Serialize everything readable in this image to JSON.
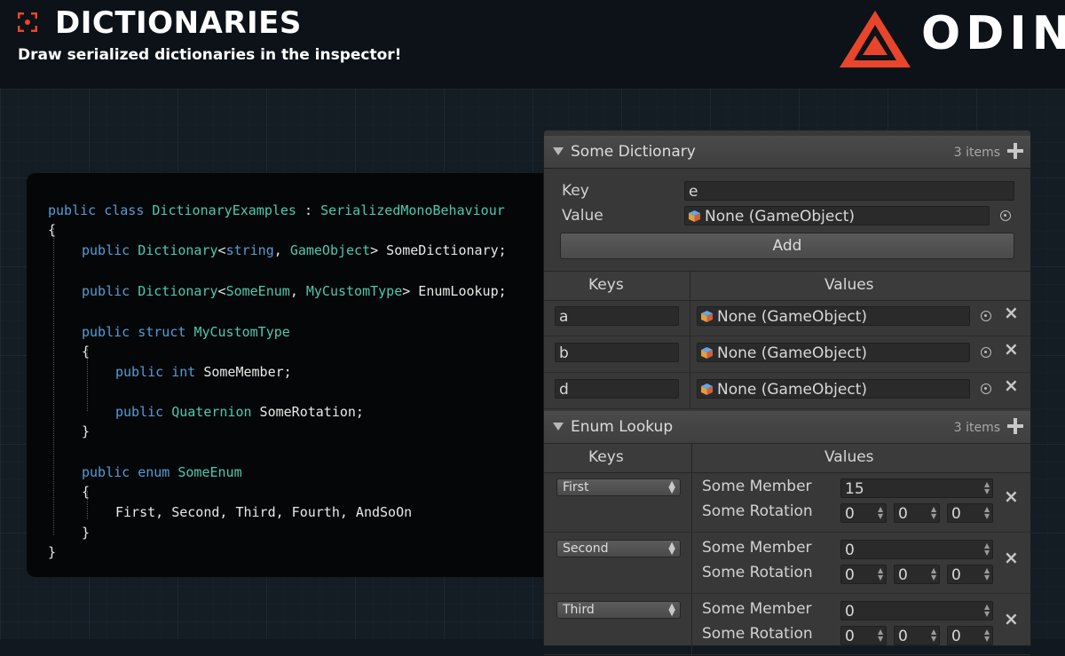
{
  "header": {
    "title": "DICTIONARIES",
    "subtitle": "Draw serialized dictionaries in the inspector!",
    "logo_text": "ODIN",
    "logo_color": "#e8452c"
  },
  "code": {
    "lines": [
      {
        "indent": 0,
        "parts": [
          [
            "kw",
            "public class "
          ],
          [
            "ty",
            "DictionaryExamples"
          ],
          [
            "pl",
            " : "
          ],
          [
            "ty",
            "SerializedMonoBehaviour"
          ]
        ]
      },
      {
        "indent": 0,
        "parts": [
          [
            "pl",
            "{"
          ]
        ]
      },
      {
        "indent": 1,
        "parts": [
          [
            "kw",
            "public "
          ],
          [
            "ty",
            "Dictionary"
          ],
          [
            "pl",
            "<"
          ],
          [
            "kw",
            "string"
          ],
          [
            "pl",
            ", "
          ],
          [
            "ty",
            "GameObject"
          ],
          [
            "pl",
            "> SomeDictionary;"
          ]
        ]
      },
      {
        "indent": 1,
        "parts": [
          [
            "kw",
            "public "
          ],
          [
            "ty",
            "Dictionary"
          ],
          [
            "pl",
            "<"
          ],
          [
            "ty",
            "SomeEnum"
          ],
          [
            "pl",
            ", "
          ],
          [
            "ty",
            "MyCustomType"
          ],
          [
            "pl",
            "> EnumLookup;"
          ]
        ]
      },
      {
        "indent": 1,
        "parts": [
          [
            "kw",
            "public struct "
          ],
          [
            "ty",
            "MyCustomType"
          ]
        ]
      },
      {
        "indent": 1,
        "parts": [
          [
            "pl",
            "{"
          ]
        ]
      },
      {
        "indent": 2,
        "parts": [
          [
            "kw",
            "public int "
          ],
          [
            "pl",
            "SomeMember;"
          ]
        ]
      },
      {
        "indent": 2,
        "parts": [
          [
            "kw",
            "public "
          ],
          [
            "ty",
            "Quaternion"
          ],
          [
            "pl",
            " SomeRotation;"
          ]
        ]
      },
      {
        "indent": 1,
        "parts": [
          [
            "pl",
            "}"
          ]
        ]
      },
      {
        "indent": 1,
        "parts": [
          [
            "kw",
            "public enum "
          ],
          [
            "ty",
            "SomeEnum"
          ]
        ]
      },
      {
        "indent": 1,
        "parts": [
          [
            "pl",
            "{"
          ]
        ]
      },
      {
        "indent": 2,
        "parts": [
          [
            "pl",
            "First, Second, Third, Fourth, AndSoOn"
          ]
        ]
      },
      {
        "indent": 1,
        "parts": [
          [
            "pl",
            "}"
          ]
        ]
      },
      {
        "indent": 0,
        "parts": [
          [
            "pl",
            "}"
          ]
        ]
      }
    ]
  },
  "some_dictionary": {
    "title": "Some Dictionary",
    "count": "3 items",
    "key_label": "Key",
    "key_value": "e",
    "value_label": "Value",
    "value_value": "None (GameObject)",
    "add_label": "Add",
    "col_keys": "Keys",
    "col_values": "Values",
    "rows": [
      {
        "key": "a",
        "value": "None (GameObject)"
      },
      {
        "key": "b",
        "value": "None (GameObject)"
      },
      {
        "key": "d",
        "value": "None (GameObject)"
      }
    ]
  },
  "enum_lookup": {
    "title": "Enum Lookup",
    "count": "3 items",
    "col_keys": "Keys",
    "col_values": "Values",
    "member_label": "Some Member",
    "rotation_label": "Some Rotation",
    "rows": [
      {
        "key": "First",
        "member": "15",
        "rot": [
          "0",
          "0",
          "0"
        ]
      },
      {
        "key": "Second",
        "member": "0",
        "rot": [
          "0",
          "0",
          "0"
        ]
      },
      {
        "key": "Third",
        "member": "0",
        "rot": [
          "0",
          "0",
          "0"
        ]
      }
    ]
  }
}
